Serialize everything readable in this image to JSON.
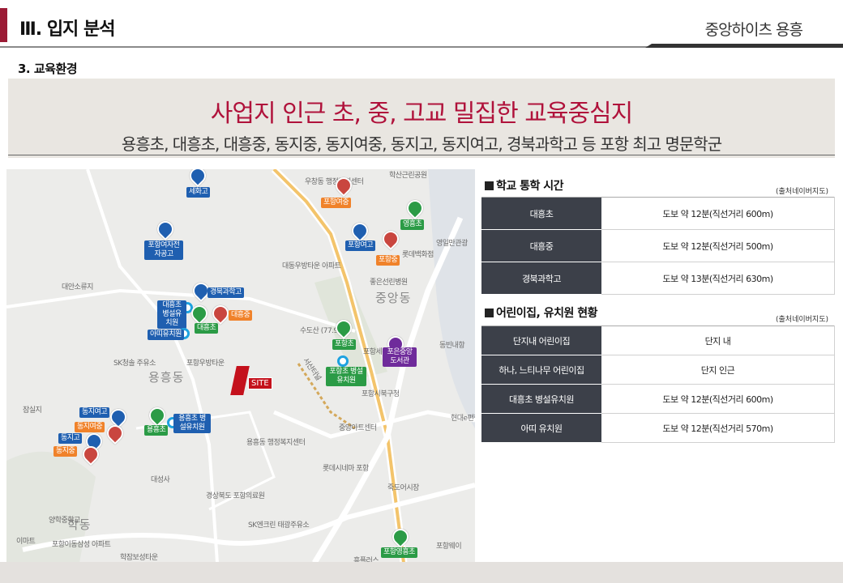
{
  "header": {
    "section_title": "Ⅲ. 입지 분석",
    "brand": "중앙하이츠 용흥",
    "subsection": "3. 교육환경"
  },
  "banner": {
    "headline": "사업지 인근 초, 중, 고교 밀집한 교육중심지",
    "subline": "용흥초, 대흥초, 대흥중, 동지중, 동지여중, 동지고, 동지여고, 경북과학고 등 포항 최고 명문학군"
  },
  "map": {
    "districts": [
      "용흥동",
      "중앙동",
      "학동"
    ],
    "site_label": "SITE",
    "labels": [
      "세화고",
      "포항여중",
      "영흥초",
      "포항여고",
      "포항중",
      "포항여자전자공고",
      "경북과학고",
      "대흥중",
      "대흥초 병설유치원",
      "대흥초",
      "아띠유치원",
      "포항초",
      "포항초 병설유치원",
      "포은중앙도서관",
      "동지여고",
      "동지여중",
      "동지고",
      "동지중",
      "용흥초",
      "용흥초 병설유치원",
      "포항영흥초"
    ],
    "place_labels": [
      "우창동 행정복지센터",
      "대동우방타운 아파트",
      "수도산 (77.9m)",
      "포항세무서",
      "SK청솔 주유소",
      "포항우방타운",
      "중앙아트센터",
      "용흥동 행정복지센터",
      "롯데시네마 포항",
      "경상북도 포항의료원",
      "SK엔크린 태광주유소",
      "대성사",
      "죽도어시장",
      "포항이동삼성 아파트",
      "학잠보성타운",
      "포항시북구청",
      "잠실지",
      "대안소류지",
      "양학중학교",
      "롯데백화점",
      "현대e편한 주유",
      "좋은선린병원",
      "영일만관광",
      "서산터널",
      "이마트",
      "흥플러스",
      "동빈내항",
      "학산근린공원",
      "포항웨이"
    ]
  },
  "commute": {
    "title": "학교 통학 시간",
    "source": "(출처네이버지도)",
    "rows": [
      {
        "name": "대흥초",
        "value": "도보 약 12분(직선거리 600m)"
      },
      {
        "name": "대흥중",
        "value": "도보 약 12분(직선거리 500m)"
      },
      {
        "name": "경북과학고",
        "value": "도보 약 13분(직선거리 630m)"
      }
    ]
  },
  "daycare": {
    "title": "어린이집, 유치원 현황",
    "source": "(출처네이버지도)",
    "rows": [
      {
        "name": "단지내 어린이집",
        "value": "단지 내"
      },
      {
        "name": "하나, 느티나무 어린이집",
        "value": "단지 인근"
      },
      {
        "name": "대흥초 병설유치원",
        "value": "도보 약 12분(직선거리 600m)"
      },
      {
        "name": "아띠 유치원",
        "value": "도보 약 12분(직선거리 570m)"
      }
    ]
  },
  "colors": {
    "accent": "#9b1b35",
    "headline": "#b0123b",
    "table_key": "#3c4049",
    "site": "#c4111c"
  }
}
